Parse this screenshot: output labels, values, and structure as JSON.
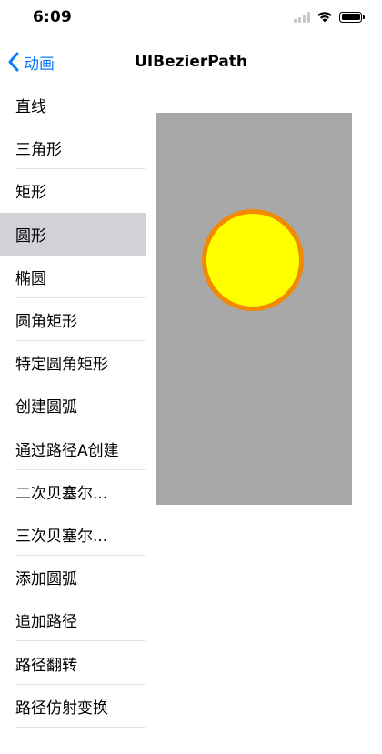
{
  "status_bar": {
    "time": "6:09"
  },
  "nav": {
    "back_label": "动画",
    "title": "UIBezierPath"
  },
  "sidebar": {
    "items": [
      {
        "label": "直线"
      },
      {
        "label": "三角形"
      },
      {
        "label": "矩形"
      },
      {
        "label": "圆形"
      },
      {
        "label": "椭圆"
      },
      {
        "label": "圆角矩形"
      },
      {
        "label": "特定圆角矩形"
      },
      {
        "label": "创建圆弧"
      },
      {
        "label": "通过路径A创建"
      },
      {
        "label": "二次贝塞尔..."
      },
      {
        "label": "三次贝塞尔..."
      },
      {
        "label": "添加圆弧"
      },
      {
        "label": "追加路径"
      },
      {
        "label": "路径翻转"
      },
      {
        "label": "路径仿射变换"
      }
    ],
    "selected_label": "圆形"
  },
  "canvas": {
    "background": "#a8a8a8",
    "shape": {
      "type": "circle",
      "fill": "#ffff00",
      "stroke": "#f28a00"
    }
  },
  "colors": {
    "accent": "#0a7aff",
    "selected_row": "#d1d1d6"
  }
}
